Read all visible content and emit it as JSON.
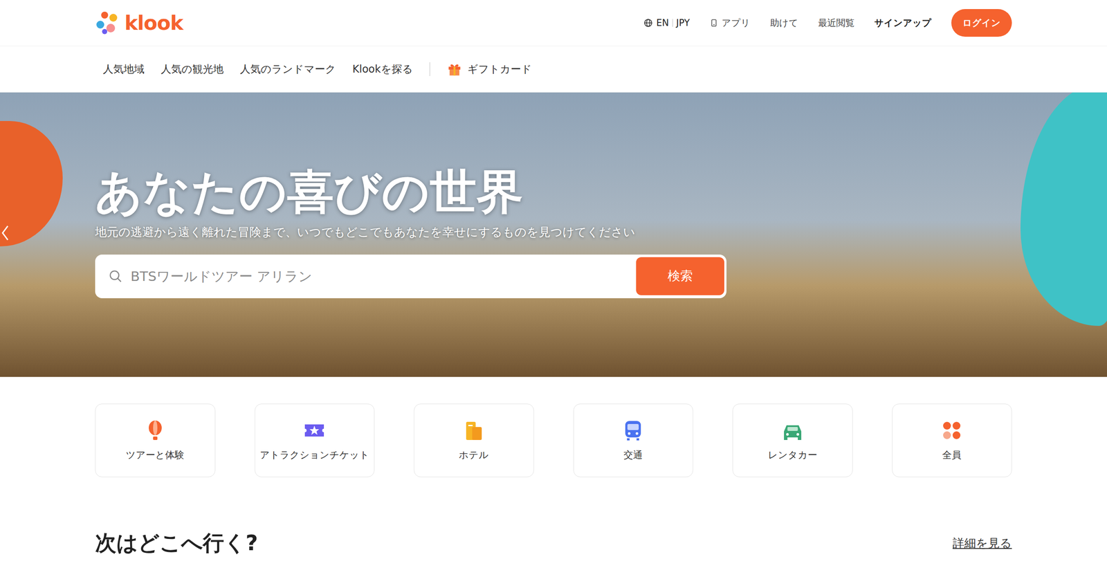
{
  "header": {
    "logo": "klook",
    "language": "EN",
    "currency": "JPY",
    "links": [
      "アプリ",
      "助けて",
      "最近閲覧"
    ],
    "signup": "サインアップ",
    "login": "ログイン"
  },
  "nav": {
    "items": [
      "人気地域",
      "人気の観光地",
      "人気のランドマーク",
      "Klookを探る"
    ],
    "gift": "ギフトカード"
  },
  "hero": {
    "title": "あなたの喜びの世界",
    "subtitle": "地元の逃避から遠く離れた冒険まで、いつでもどこでもあなたを幸せにするものを見つけてください"
  },
  "search": {
    "placeholder": "BTSワールドツアー アリラン",
    "button": "検索"
  },
  "categories": [
    {
      "label": "ツアーと体験",
      "kind": "balloon",
      "color": "#f5622e"
    },
    {
      "label": "アトラクションチケット",
      "kind": "ticket",
      "color": "#6b5cf0"
    },
    {
      "label": "ホテル",
      "kind": "hotel",
      "color": "#f7b526"
    },
    {
      "label": "交通",
      "kind": "transit",
      "color": "#4a72f0"
    },
    {
      "label": "レンタカー",
      "kind": "car",
      "color": "#3aa876"
    },
    {
      "label": "全員",
      "kind": "all",
      "color": "#f5622e"
    }
  ],
  "section": {
    "title": "次はどこへ行く?",
    "more": "詳細を見る"
  }
}
